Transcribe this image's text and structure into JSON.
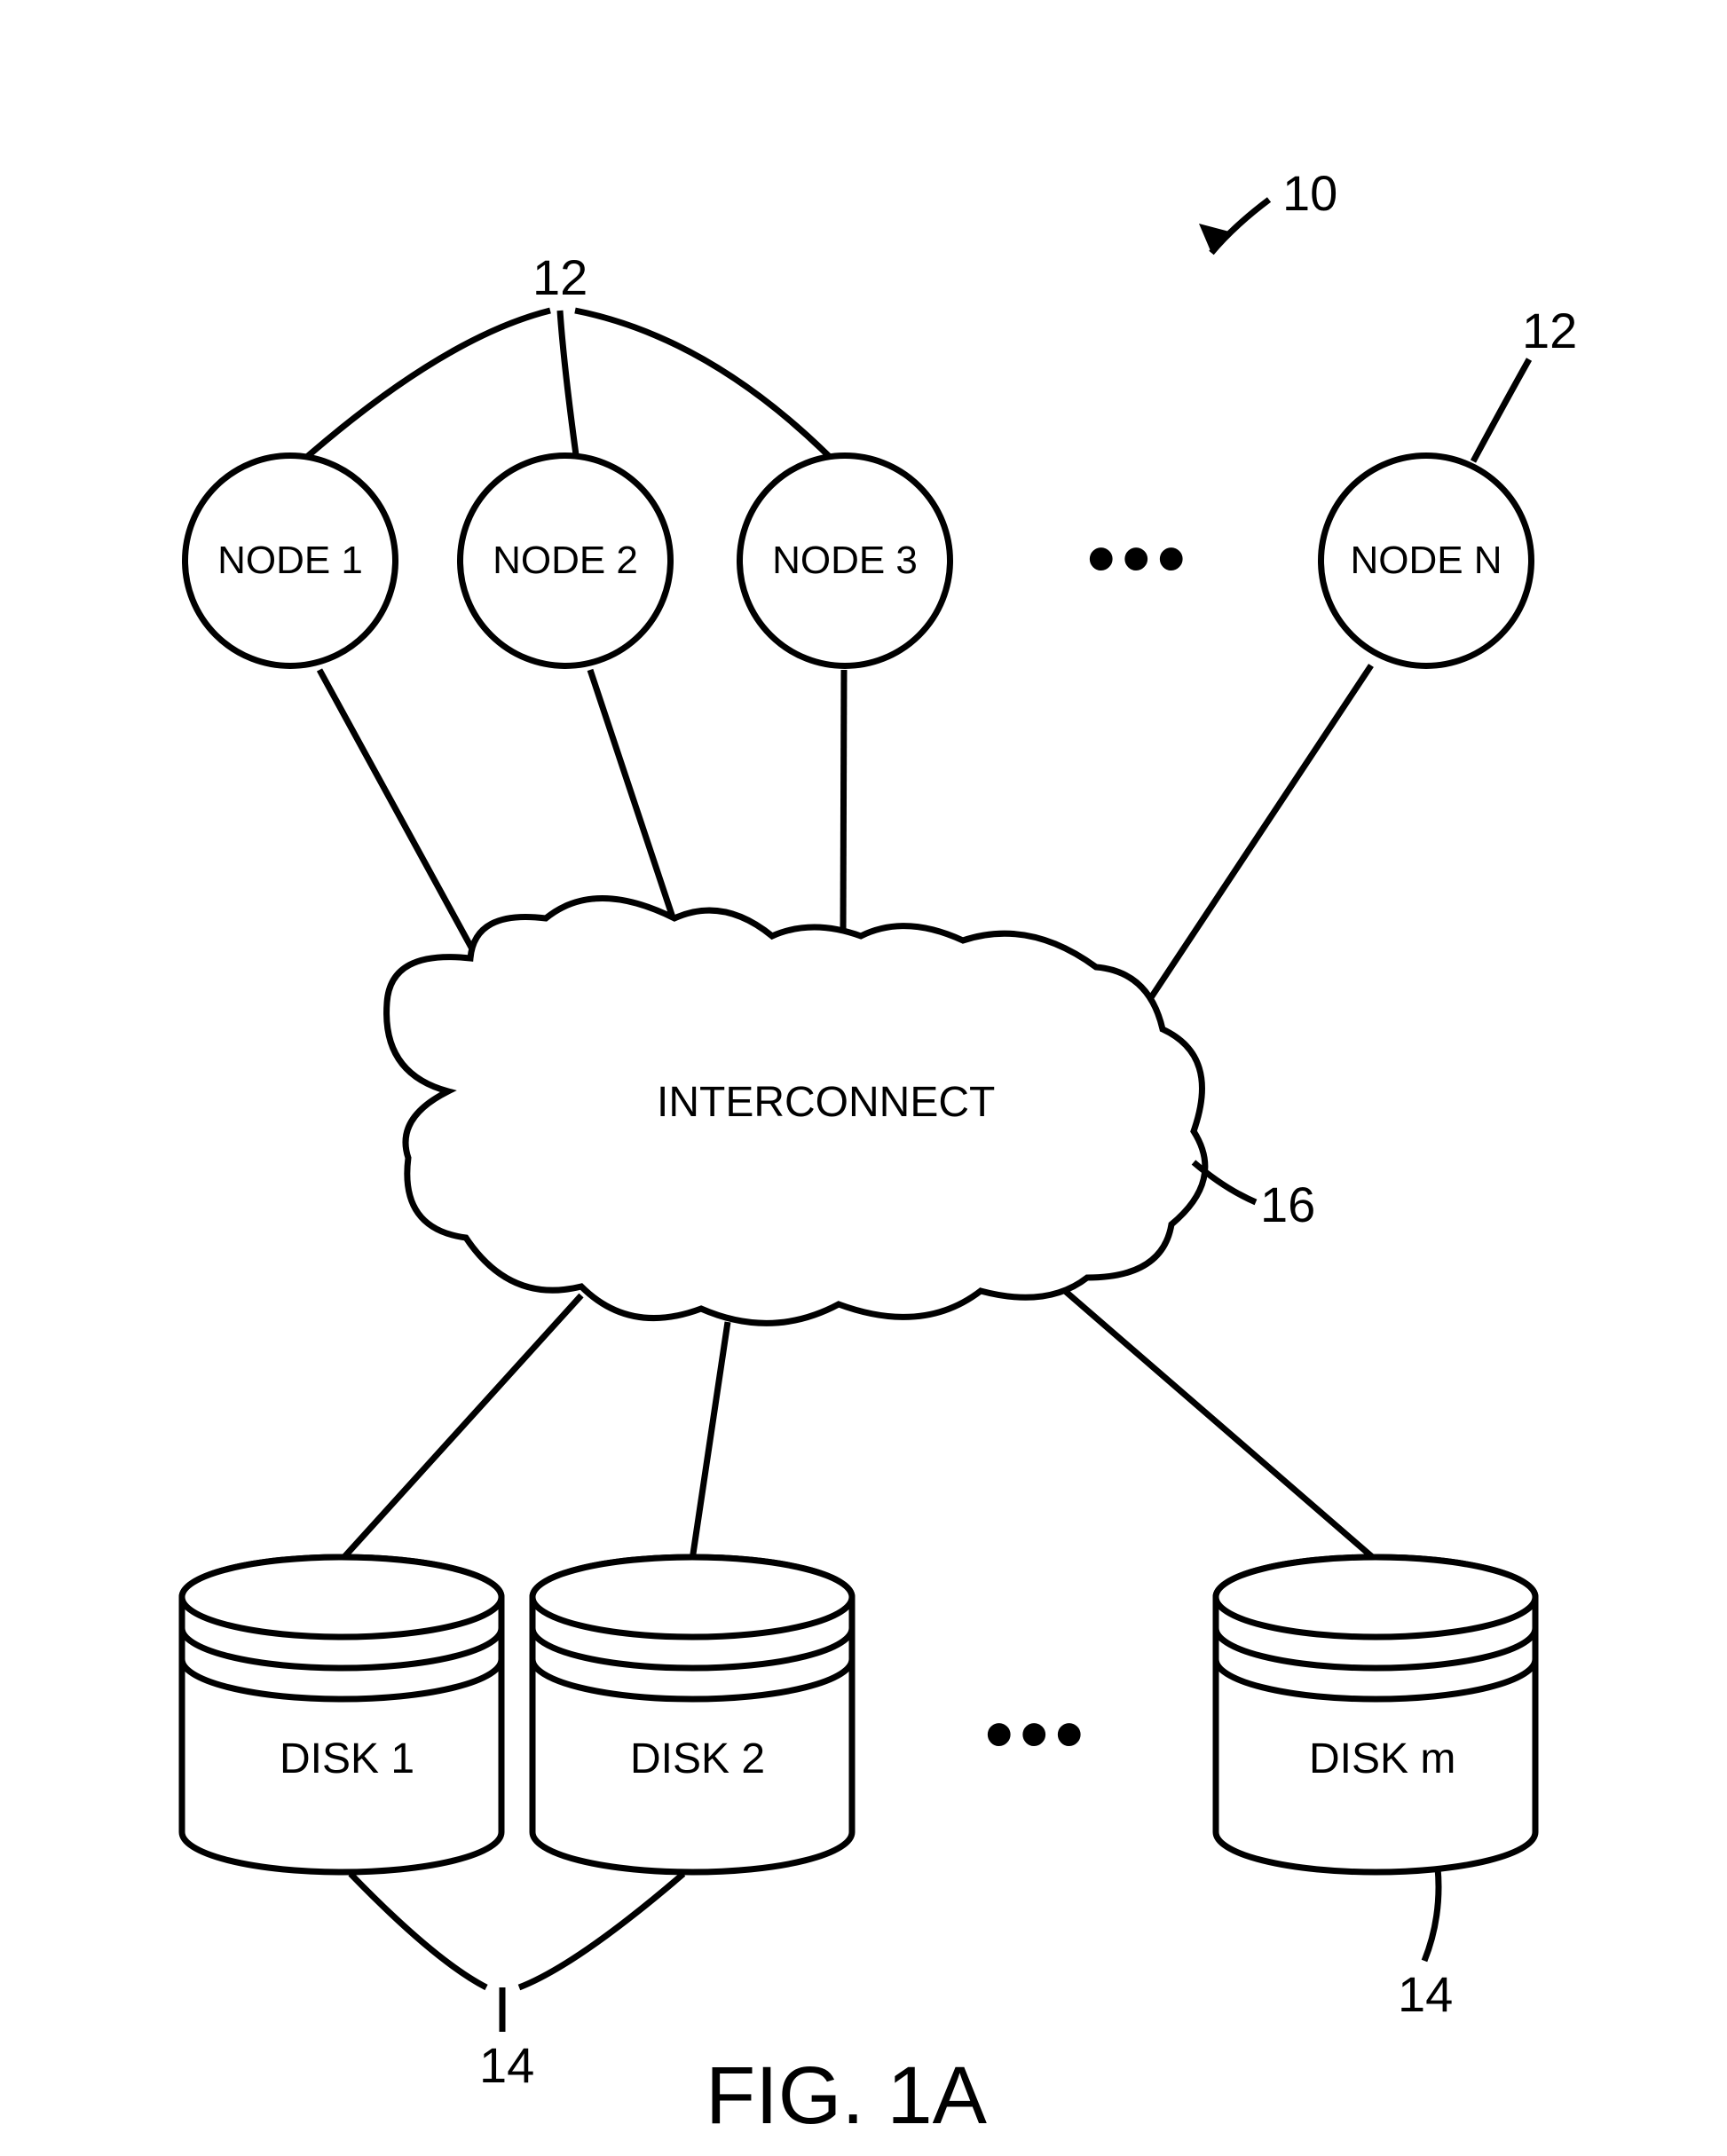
{
  "refs": {
    "system": "10",
    "node_group": "12",
    "node_n": "12",
    "disk_group": "14",
    "disk_m": "14",
    "interconnect": "16"
  },
  "nodes": {
    "n1": "NODE 1",
    "n2": "NODE 2",
    "n3": "NODE 3",
    "ellipsis": "•••",
    "nn": "NODE N"
  },
  "interconnect": "INTERCONNECT",
  "disks": {
    "d1": "DISK 1",
    "d2": "DISK 2",
    "ellipsis": "•••",
    "dm": "DISK m"
  },
  "figure": "FIG. 1A"
}
